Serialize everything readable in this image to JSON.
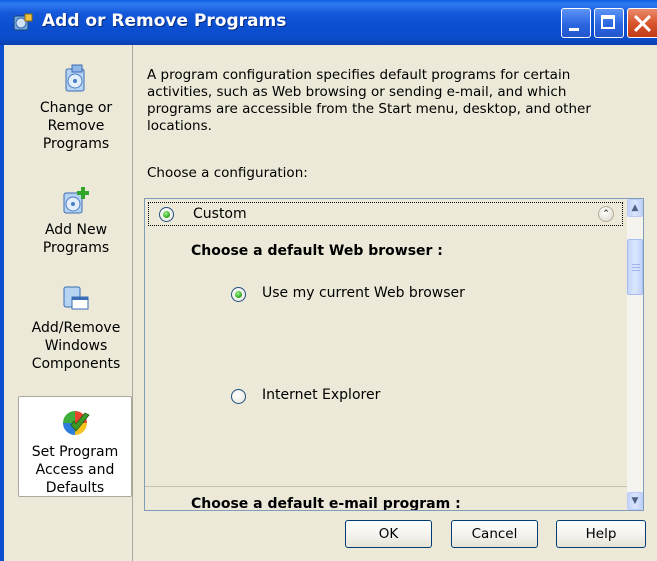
{
  "window": {
    "title": "Add or Remove Programs"
  },
  "sidebar": {
    "items": [
      {
        "label": "Change or Remove Programs",
        "icon": "change-remove-icon"
      },
      {
        "label": "Add New Programs",
        "icon": "add-new-icon"
      },
      {
        "label": "Add/Remove Windows Components",
        "icon": "windows-components-icon"
      },
      {
        "label": "Set Program Access and Defaults",
        "icon": "set-access-defaults-icon",
        "selected": true
      }
    ]
  },
  "content": {
    "description": "A program configuration specifies default programs for certain activities, such as Web browsing or sending e-mail, and which programs are accessible from the Start menu, desktop, and other locations.",
    "choose_label": "Choose a configuration:",
    "configuration": {
      "name": "Custom",
      "selected": true,
      "web_browser_heading": "Choose a default Web browser :",
      "web_browser_options": [
        {
          "label": "Use my current Web browser",
          "checked": true
        },
        {
          "label": "Internet Explorer",
          "checked": false
        }
      ],
      "email_heading": "Choose a default e-mail program :"
    }
  },
  "buttons": {
    "ok": "OK",
    "cancel": "Cancel",
    "help": "Help"
  },
  "colors": {
    "title_bar": "#0b4fd1",
    "window_bg": "#ece9d8",
    "radio_checked": "#29a317"
  }
}
